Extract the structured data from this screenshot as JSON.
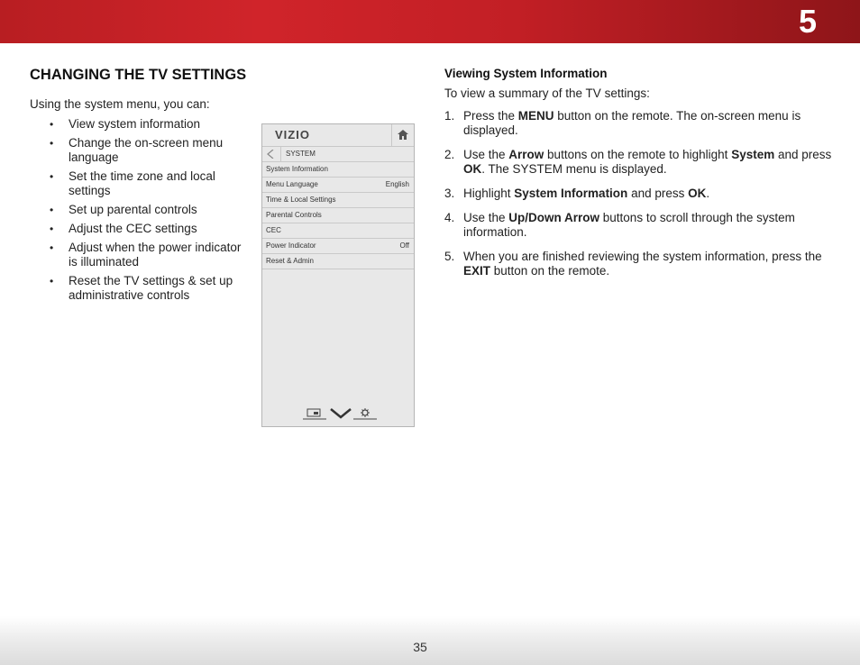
{
  "header": {
    "chapter_number": "5",
    "accent_color": "#c21f25"
  },
  "left": {
    "title": "CHANGING THE TV SETTINGS",
    "intro": "Using the system menu, you can:",
    "bullets": [
      "View system information",
      "Change the on-screen menu language",
      "Set the time zone and local settings",
      "Set up parental controls",
      "Adjust the CEC settings",
      "Adjust when the power indicator is illuminated",
      "Reset the TV settings & set up administrative controls"
    ],
    "bullet_char": "•"
  },
  "tv_menu": {
    "logo": "VIZIO",
    "title": "SYSTEM",
    "items": [
      {
        "label": "System Information",
        "value": ""
      },
      {
        "label": "Menu Language",
        "value": "English"
      },
      {
        "label": "Time & Local Settings",
        "value": ""
      },
      {
        "label": "Parental Controls",
        "value": ""
      },
      {
        "label": "CEC",
        "value": ""
      },
      {
        "label": "Power Indicator",
        "value": "Off"
      },
      {
        "label": "Reset & Admin",
        "value": ""
      }
    ],
    "icons": [
      "home-icon",
      "back-arrow-icon",
      "wide-icon",
      "vizio-v-icon",
      "settings-icon"
    ]
  },
  "right": {
    "heading": "Viewing System Information",
    "intro": "To view a summary of the TV settings:",
    "steps": [
      {
        "num": "1.",
        "parts": [
          {
            "t": "Press the ",
            "b": false
          },
          {
            "t": "MENU",
            "b": true
          },
          {
            "t": " button on the remote. The on-screen menu is displayed.",
            "b": false
          }
        ]
      },
      {
        "num": "2.",
        "parts": [
          {
            "t": "Use the ",
            "b": false
          },
          {
            "t": "Arrow",
            "b": true
          },
          {
            "t": " buttons on the remote to highlight ",
            "b": false
          },
          {
            "t": "System",
            "b": true
          },
          {
            "t": " and press ",
            "b": false
          },
          {
            "t": "OK",
            "b": true
          },
          {
            "t": ". The SYSTEM menu is displayed.",
            "b": false
          }
        ]
      },
      {
        "num": "3.",
        "parts": [
          {
            "t": "Highlight ",
            "b": false
          },
          {
            "t": "System Information",
            "b": true
          },
          {
            "t": " and press ",
            "b": false
          },
          {
            "t": "OK",
            "b": true
          },
          {
            "t": ".",
            "b": false
          }
        ]
      },
      {
        "num": "4.",
        "parts": [
          {
            "t": "Use the ",
            "b": false
          },
          {
            "t": "Up/Down Arrow",
            "b": true
          },
          {
            "t": " buttons to scroll through the system information.",
            "b": false
          }
        ]
      },
      {
        "num": "5.",
        "parts": [
          {
            "t": "When you are finished reviewing the system information, press the ",
            "b": false
          },
          {
            "t": "EXIT",
            "b": true
          },
          {
            "t": " button on the remote.",
            "b": false
          }
        ]
      }
    ]
  },
  "footer": {
    "page_number": "35"
  }
}
